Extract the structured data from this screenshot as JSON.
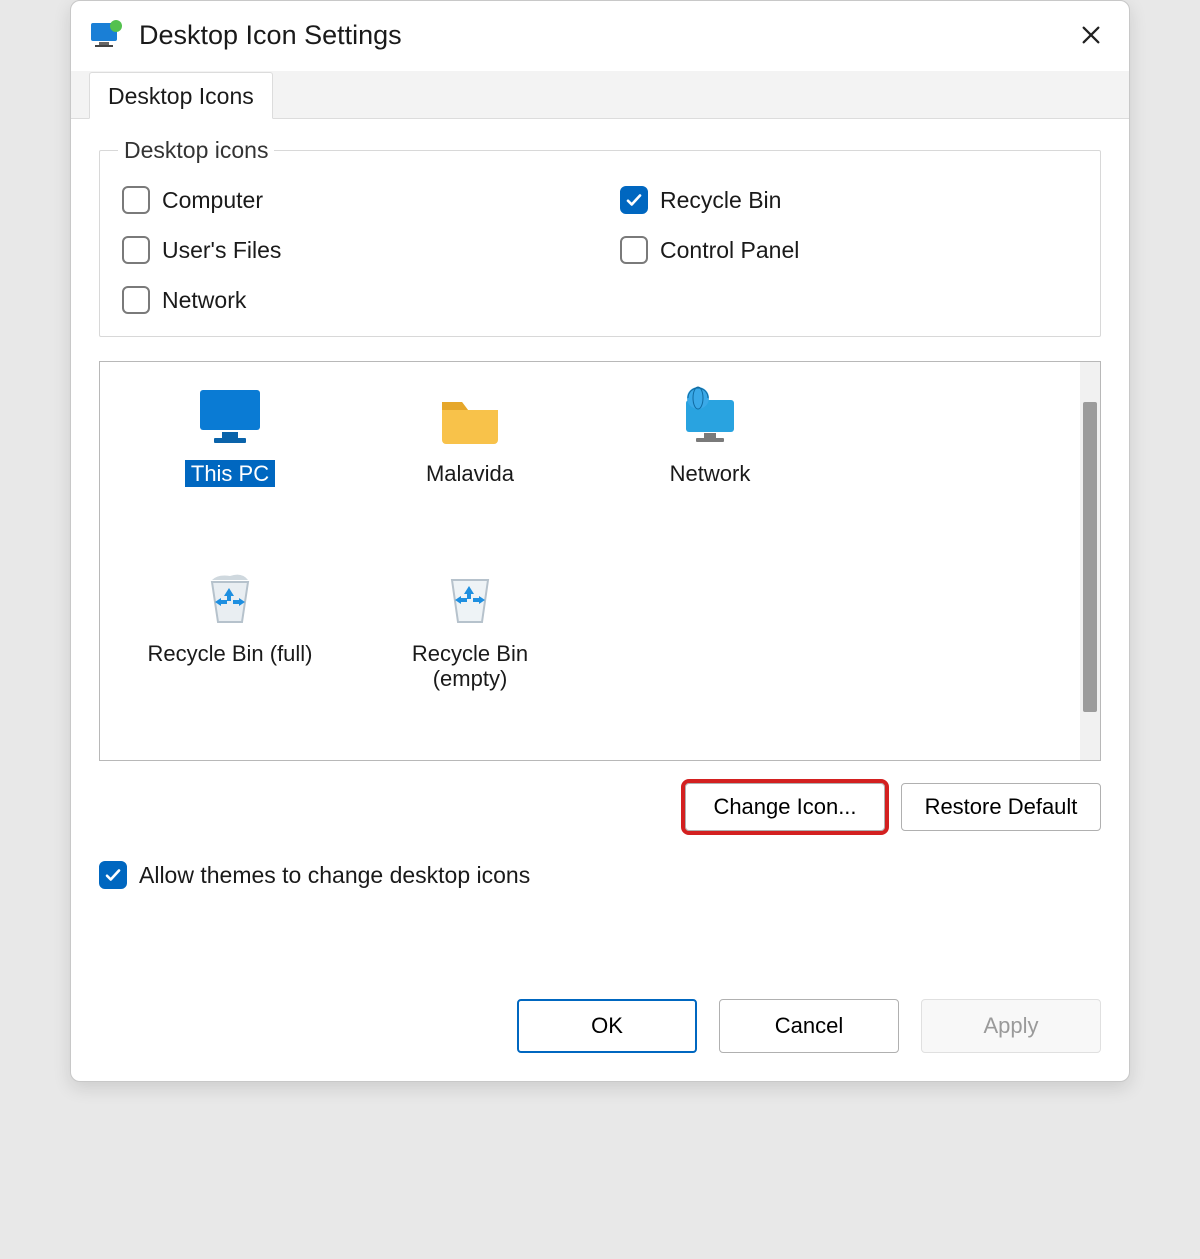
{
  "window": {
    "title": "Desktop Icon Settings"
  },
  "tabs": [
    {
      "label": "Desktop Icons",
      "active": true
    }
  ],
  "group": {
    "legend": "Desktop icons",
    "checks": [
      {
        "label": "Computer",
        "checked": false
      },
      {
        "label": "Recycle Bin",
        "checked": true
      },
      {
        "label": "User's Files",
        "checked": false
      },
      {
        "label": "Control Panel",
        "checked": false
      },
      {
        "label": "Network",
        "checked": false
      }
    ]
  },
  "icons": [
    {
      "label": "This PC",
      "kind": "monitor",
      "selected": true
    },
    {
      "label": "Malavida",
      "kind": "folder",
      "selected": false
    },
    {
      "label": "Network",
      "kind": "network",
      "selected": false
    },
    {
      "label": "Recycle Bin (full)",
      "kind": "recycle-full",
      "selected": false
    },
    {
      "label": "Recycle Bin (empty)",
      "kind": "recycle-empty",
      "selected": false
    }
  ],
  "buttons": {
    "change_icon": "Change Icon...",
    "restore_default": "Restore Default",
    "ok": "OK",
    "cancel": "Cancel",
    "apply": "Apply"
  },
  "theme_check": {
    "label": "Allow themes to change desktop icons",
    "checked": true
  }
}
